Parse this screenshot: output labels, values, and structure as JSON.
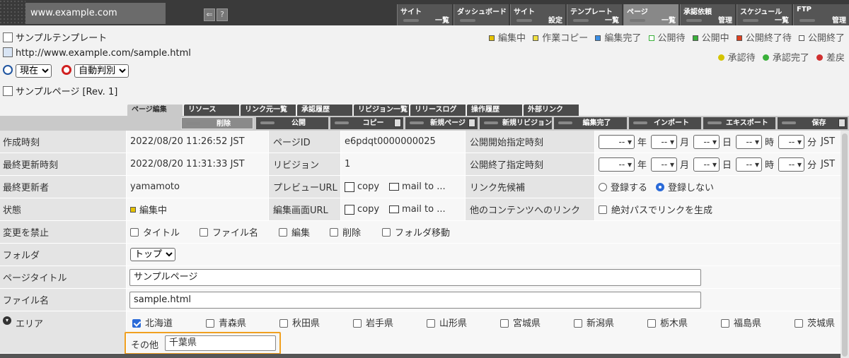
{
  "topbar": {
    "domain": "www.example.com",
    "nav": [
      {
        "t1": "サイト",
        "t2": "一覧"
      },
      {
        "t1": "ダッシュボード",
        "t2": ""
      },
      {
        "t1": "サイト",
        "t2": "設定"
      },
      {
        "t1": "テンプレート",
        "t2": "一覧"
      },
      {
        "t1": "ページ",
        "t2": "一覧"
      },
      {
        "t1": "承認依頼",
        "t2": "管理"
      },
      {
        "t1": "スケジュール",
        "t2": "一覧"
      },
      {
        "t1": "FTP",
        "t2": "管理"
      }
    ]
  },
  "info": {
    "template": "サンプルテンプレート",
    "url": "http://www.example.com/sample.html",
    "time_select": "現在",
    "mode_select": "自動判別",
    "page_name": "サンプルページ [Rev. 1]"
  },
  "legend": {
    "status": [
      {
        "label": "編集中",
        "color": "#e6c200"
      },
      {
        "label": "作業コピー",
        "color": "#f0e040"
      },
      {
        "label": "編集完了",
        "color": "#3a8ee6"
      },
      {
        "label": "公開待",
        "color": "#ffffff"
      },
      {
        "label": "公開中",
        "color": "#3ab03a"
      },
      {
        "label": "公開終了待",
        "color": "#e04020"
      },
      {
        "label": "公開終了",
        "color": "#ffffff"
      }
    ],
    "approval": [
      {
        "label": "承認待",
        "color": "#d4c400"
      },
      {
        "label": "承認完了",
        "color": "#3ab03a"
      },
      {
        "label": "差戻",
        "color": "#d03030"
      }
    ]
  },
  "tabs": [
    "ページ編集",
    "リソース",
    "リンク元一覧",
    "承認履歴",
    "リビジョン一覧",
    "リリースログ",
    "操作履歴",
    "外部リンク"
  ],
  "actions": [
    "削除",
    "公開",
    "コピー",
    "新規ページ",
    "新規リビジョン",
    "編集完了",
    "インポート",
    "エキスポート",
    "保存"
  ],
  "form": {
    "created_label": "作成時刻",
    "created": "2022/08/20 11:26:52 JST",
    "pageid_label": "ページID",
    "pageid": "e6pdqt0000000025",
    "pubstart_label": "公開開始指定時刻",
    "updated_label": "最終更新時刻",
    "updated": "2022/08/20 11:31:33 JST",
    "revision_label": "リビジョン",
    "revision": "1",
    "pubend_label": "公開終了指定時刻",
    "updater_label": "最終更新者",
    "updater": "yamamoto",
    "preview_label": "プレビューURL",
    "copy": "copy",
    "mailto": "mail to ...",
    "linkcand_label": "リンク先候補",
    "register": "登録する",
    "noregister": "登録しない",
    "state_label": "状態",
    "state": "編集中",
    "editurl_label": "編集画面URL",
    "otherlink_label": "他のコンテンツへのリンク",
    "abspath": "絶対パスでリンクを生成",
    "prohibit_label": "変更を禁止",
    "prohibit": [
      "タイトル",
      "ファイル名",
      "編集",
      "削除",
      "フォルダ移動"
    ],
    "folder_label": "フォルダ",
    "folder": "トップ",
    "title_label": "ページタイトル",
    "title": "サンプルページ",
    "filename_label": "ファイル名",
    "filename": "sample.html",
    "area_label": "エリア",
    "areas": [
      "北海道",
      "青森県",
      "秋田県",
      "岩手県",
      "山形県",
      "宮城県",
      "新潟県",
      "栃木県",
      "福島県",
      "茨城県"
    ],
    "other_label": "その他",
    "other": "千葉県",
    "date_units": [
      "年",
      "月",
      "日",
      "時",
      "分",
      "JST"
    ],
    "date_placeholder": "--"
  }
}
